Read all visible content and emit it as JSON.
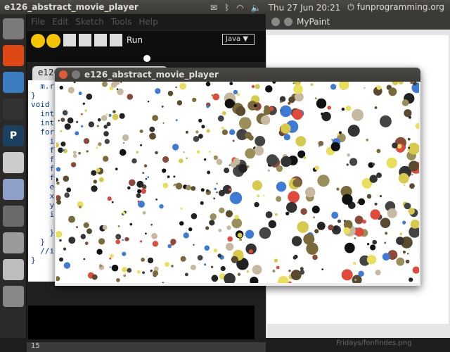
{
  "topbar": {
    "app_title": "e126_abstract_movie_player",
    "datetime": "Thu 27 Jun 20:21",
    "user": "funprogramming.org"
  },
  "launcher": {
    "items": [
      {
        "name": "ubuntu-dash-icon",
        "color": "#7a7a7a"
      },
      {
        "name": "app-store-icon",
        "color": "#dd4814"
      },
      {
        "name": "chrome-icon",
        "color": "#3b7bbf"
      },
      {
        "name": "terminal-icon",
        "color": "#333333"
      },
      {
        "name": "processing-icon",
        "color": "#1c4060",
        "label": "P"
      },
      {
        "name": "text-editor-icon",
        "color": "#cccccc"
      },
      {
        "name": "image-editor-icon",
        "color": "#8fa0c8"
      },
      {
        "name": "gray-app-icon",
        "color": "#6b6b6b"
      },
      {
        "name": "display-icon",
        "color": "#9a9a9a"
      },
      {
        "name": "drive-icon",
        "color": "#bdbdbd"
      },
      {
        "name": "trash-icon",
        "color": "#888888"
      }
    ]
  },
  "ide": {
    "menu": [
      "File",
      "Edit",
      "Sketch",
      "Tools",
      "Help"
    ],
    "run_label": "Run",
    "mode_label": "Java ▼",
    "tab_label": "e126_abstract_movie_player",
    "code_lines": [
      "  m.r",
      "}",
      "void",
      "  int",
      "  int",
      "  for",
      "    i",
      "    f",
      "    f",
      "    f",
      "    f",
      "    e",
      "    x",
      "    y",
      "    i",
      "",
      "    }",
      "  }",
      "  //i",
      "}"
    ],
    "line_number": "15"
  },
  "mypaint": {
    "title": "MyPaint",
    "caption": "Fridays/fonfindes.png"
  },
  "player": {
    "title": "e126_abstract_movie_player"
  }
}
